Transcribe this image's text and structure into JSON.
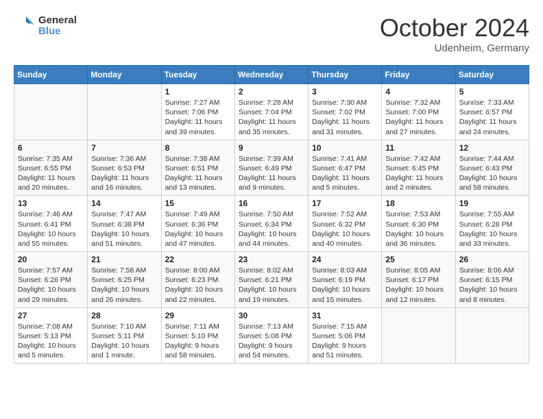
{
  "header": {
    "logo_general": "General",
    "logo_blue": "Blue",
    "month_title": "October 2024",
    "location": "Udenheim, Germany"
  },
  "days_of_week": [
    "Sunday",
    "Monday",
    "Tuesday",
    "Wednesday",
    "Thursday",
    "Friday",
    "Saturday"
  ],
  "weeks": [
    [
      {
        "day": "",
        "sunrise": "",
        "sunset": "",
        "daylight": ""
      },
      {
        "day": "",
        "sunrise": "",
        "sunset": "",
        "daylight": ""
      },
      {
        "day": "1",
        "sunrise": "Sunrise: 7:27 AM",
        "sunset": "Sunset: 7:06 PM",
        "daylight": "Daylight: 11 hours and 39 minutes."
      },
      {
        "day": "2",
        "sunrise": "Sunrise: 7:28 AM",
        "sunset": "Sunset: 7:04 PM",
        "daylight": "Daylight: 11 hours and 35 minutes."
      },
      {
        "day": "3",
        "sunrise": "Sunrise: 7:30 AM",
        "sunset": "Sunset: 7:02 PM",
        "daylight": "Daylight: 11 hours and 31 minutes."
      },
      {
        "day": "4",
        "sunrise": "Sunrise: 7:32 AM",
        "sunset": "Sunset: 7:00 PM",
        "daylight": "Daylight: 11 hours and 27 minutes."
      },
      {
        "day": "5",
        "sunrise": "Sunrise: 7:33 AM",
        "sunset": "Sunset: 6:57 PM",
        "daylight": "Daylight: 11 hours and 24 minutes."
      }
    ],
    [
      {
        "day": "6",
        "sunrise": "Sunrise: 7:35 AM",
        "sunset": "Sunset: 6:55 PM",
        "daylight": "Daylight: 11 hours and 20 minutes."
      },
      {
        "day": "7",
        "sunrise": "Sunrise: 7:36 AM",
        "sunset": "Sunset: 6:53 PM",
        "daylight": "Daylight: 11 hours and 16 minutes."
      },
      {
        "day": "8",
        "sunrise": "Sunrise: 7:38 AM",
        "sunset": "Sunset: 6:51 PM",
        "daylight": "Daylight: 11 hours and 13 minutes."
      },
      {
        "day": "9",
        "sunrise": "Sunrise: 7:39 AM",
        "sunset": "Sunset: 6:49 PM",
        "daylight": "Daylight: 11 hours and 9 minutes."
      },
      {
        "day": "10",
        "sunrise": "Sunrise: 7:41 AM",
        "sunset": "Sunset: 6:47 PM",
        "daylight": "Daylight: 11 hours and 5 minutes."
      },
      {
        "day": "11",
        "sunrise": "Sunrise: 7:42 AM",
        "sunset": "Sunset: 6:45 PM",
        "daylight": "Daylight: 11 hours and 2 minutes."
      },
      {
        "day": "12",
        "sunrise": "Sunrise: 7:44 AM",
        "sunset": "Sunset: 6:43 PM",
        "daylight": "Daylight: 10 hours and 58 minutes."
      }
    ],
    [
      {
        "day": "13",
        "sunrise": "Sunrise: 7:46 AM",
        "sunset": "Sunset: 6:41 PM",
        "daylight": "Daylight: 10 hours and 55 minutes."
      },
      {
        "day": "14",
        "sunrise": "Sunrise: 7:47 AM",
        "sunset": "Sunset: 6:38 PM",
        "daylight": "Daylight: 10 hours and 51 minutes."
      },
      {
        "day": "15",
        "sunrise": "Sunrise: 7:49 AM",
        "sunset": "Sunset: 6:36 PM",
        "daylight": "Daylight: 10 hours and 47 minutes."
      },
      {
        "day": "16",
        "sunrise": "Sunrise: 7:50 AM",
        "sunset": "Sunset: 6:34 PM",
        "daylight": "Daylight: 10 hours and 44 minutes."
      },
      {
        "day": "17",
        "sunrise": "Sunrise: 7:52 AM",
        "sunset": "Sunset: 6:32 PM",
        "daylight": "Daylight: 10 hours and 40 minutes."
      },
      {
        "day": "18",
        "sunrise": "Sunrise: 7:53 AM",
        "sunset": "Sunset: 6:30 PM",
        "daylight": "Daylight: 10 hours and 36 minutes."
      },
      {
        "day": "19",
        "sunrise": "Sunrise: 7:55 AM",
        "sunset": "Sunset: 6:28 PM",
        "daylight": "Daylight: 10 hours and 33 minutes."
      }
    ],
    [
      {
        "day": "20",
        "sunrise": "Sunrise: 7:57 AM",
        "sunset": "Sunset: 6:26 PM",
        "daylight": "Daylight: 10 hours and 29 minutes."
      },
      {
        "day": "21",
        "sunrise": "Sunrise: 7:58 AM",
        "sunset": "Sunset: 6:25 PM",
        "daylight": "Daylight: 10 hours and 26 minutes."
      },
      {
        "day": "22",
        "sunrise": "Sunrise: 8:00 AM",
        "sunset": "Sunset: 6:23 PM",
        "daylight": "Daylight: 10 hours and 22 minutes."
      },
      {
        "day": "23",
        "sunrise": "Sunrise: 8:02 AM",
        "sunset": "Sunset: 6:21 PM",
        "daylight": "Daylight: 10 hours and 19 minutes."
      },
      {
        "day": "24",
        "sunrise": "Sunrise: 8:03 AM",
        "sunset": "Sunset: 6:19 PM",
        "daylight": "Daylight: 10 hours and 15 minutes."
      },
      {
        "day": "25",
        "sunrise": "Sunrise: 8:05 AM",
        "sunset": "Sunset: 6:17 PM",
        "daylight": "Daylight: 10 hours and 12 minutes."
      },
      {
        "day": "26",
        "sunrise": "Sunrise: 8:06 AM",
        "sunset": "Sunset: 6:15 PM",
        "daylight": "Daylight: 10 hours and 8 minutes."
      }
    ],
    [
      {
        "day": "27",
        "sunrise": "Sunrise: 7:08 AM",
        "sunset": "Sunset: 5:13 PM",
        "daylight": "Daylight: 10 hours and 5 minutes."
      },
      {
        "day": "28",
        "sunrise": "Sunrise: 7:10 AM",
        "sunset": "Sunset: 5:11 PM",
        "daylight": "Daylight: 10 hours and 1 minute."
      },
      {
        "day": "29",
        "sunrise": "Sunrise: 7:11 AM",
        "sunset": "Sunset: 5:10 PM",
        "daylight": "Daylight: 9 hours and 58 minutes."
      },
      {
        "day": "30",
        "sunrise": "Sunrise: 7:13 AM",
        "sunset": "Sunset: 5:08 PM",
        "daylight": "Daylight: 9 hours and 54 minutes."
      },
      {
        "day": "31",
        "sunrise": "Sunrise: 7:15 AM",
        "sunset": "Sunset: 5:06 PM",
        "daylight": "Daylight: 9 hours and 51 minutes."
      },
      {
        "day": "",
        "sunrise": "",
        "sunset": "",
        "daylight": ""
      },
      {
        "day": "",
        "sunrise": "",
        "sunset": "",
        "daylight": ""
      }
    ]
  ]
}
